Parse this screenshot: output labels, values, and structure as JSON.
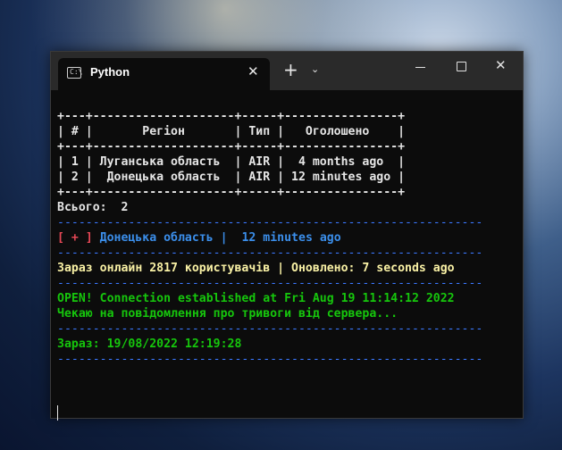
{
  "window": {
    "tab_title": "Python",
    "tab_icon": "terminal-icon",
    "close_tab_glyph": "✕",
    "new_tab_glyph": "+",
    "dropdown_glyph": "⌄",
    "close_window_glyph": "✕"
  },
  "terminal": {
    "table": {
      "border_line": "+---+--------------------+-----+----------------+",
      "header_line": "| # |       Регіон       | Тип |   Оголошено    |",
      "rows": [
        "| 1 | Луганська область  | AIR |  4 months ago  |",
        "| 2 |  Донецька область  | AIR | 12 minutes ago |"
      ]
    },
    "total_line": "Всього:  2",
    "rule": "------------------------------------------------------------",
    "alert": {
      "marker": "[ + ]",
      "region": "Донецька область",
      "separator": " | ",
      "time": "12 minutes ago"
    },
    "online_line": "Зараз онлайн 2817 користувачів | Оновлено: 7 seconds ago",
    "connection_line": "OPEN! Connection established at Fri Aug 19 11:14:12 2022",
    "waiting_line": "Чекаю на повідомлення про тривоги від сервера...",
    "now_line": "Зараз: 19/08/2022 12:19:28"
  },
  "colors": {
    "background": "#0c0c0c",
    "rule": "#3b78ff",
    "marker": "#e74856",
    "alert": "#3b8eea",
    "status": "#f9f1a5",
    "success": "#16c60c"
  }
}
